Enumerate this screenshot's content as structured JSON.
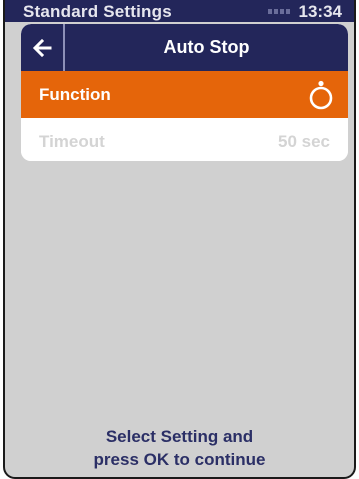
{
  "status_bar": {
    "title": "Standard Settings",
    "time": "13:34",
    "signal_icon": "signal-bars-icon"
  },
  "dialog": {
    "title": "Auto Stop",
    "back_icon": "arrow-left-icon",
    "rows": [
      {
        "label": "Function",
        "value_icon": "toggle-circle-icon",
        "selected": true
      },
      {
        "label": "Timeout",
        "value": "50 sec",
        "selected": false,
        "enabled": false
      }
    ]
  },
  "footer": {
    "line1": "Select Setting and",
    "line2": "press OK to continue"
  },
  "colors": {
    "header": "#23265a",
    "selected_row": "#e5650a",
    "background": "#d0d0d0",
    "disabled_text": "#d4d4d4",
    "footer_text": "#2b2f66"
  }
}
